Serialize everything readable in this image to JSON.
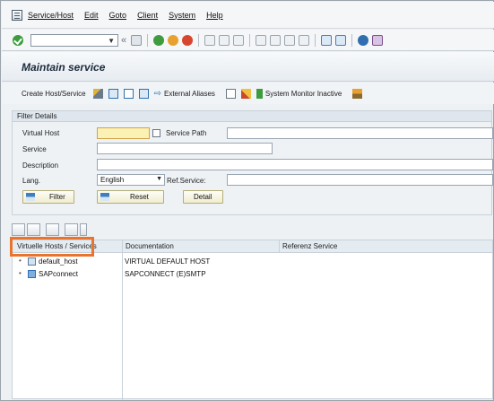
{
  "menubar": {
    "items": [
      "Service/Host",
      "Edit",
      "Goto",
      "Client",
      "System",
      "Help"
    ]
  },
  "toolbar": {
    "command_value": "",
    "back_glyph": "«"
  },
  "page": {
    "title": "Maintain service"
  },
  "app_toolbar": {
    "create_label": "Create Host/Service",
    "external_aliases_label": "External Aliases",
    "system_monitor_label": "System Monitor Inactive"
  },
  "filter": {
    "section_title": "Filter Details",
    "virtual_host_label": "Virtual Host",
    "virtual_host_value": "",
    "service_path_label": "Service Path",
    "service_path_value": "",
    "service_label": "Service",
    "service_value": "",
    "description_label": "Description",
    "description_value": "",
    "lang_label": "Lang.",
    "lang_value": "English",
    "ref_service_label": "Ref.Service:",
    "ref_service_value": "",
    "buttons": {
      "filter": "Filter",
      "reset": "Reset",
      "detail": "Detail"
    }
  },
  "tree": {
    "columns": [
      "Virtuelle Hosts / Services",
      "Documentation",
      "Referenz Service"
    ],
    "rows": [
      {
        "name": "default_host",
        "documentation": "VIRTUAL DEFAULT HOST",
        "reference": ""
      },
      {
        "name": "SAPconnect",
        "documentation": "SAPCONNECT (E)SMTP",
        "reference": ""
      }
    ]
  },
  "colors": {
    "highlight": "#e8742e",
    "required_field": "#fbf1b5",
    "button_bg": "#f1edd0"
  }
}
